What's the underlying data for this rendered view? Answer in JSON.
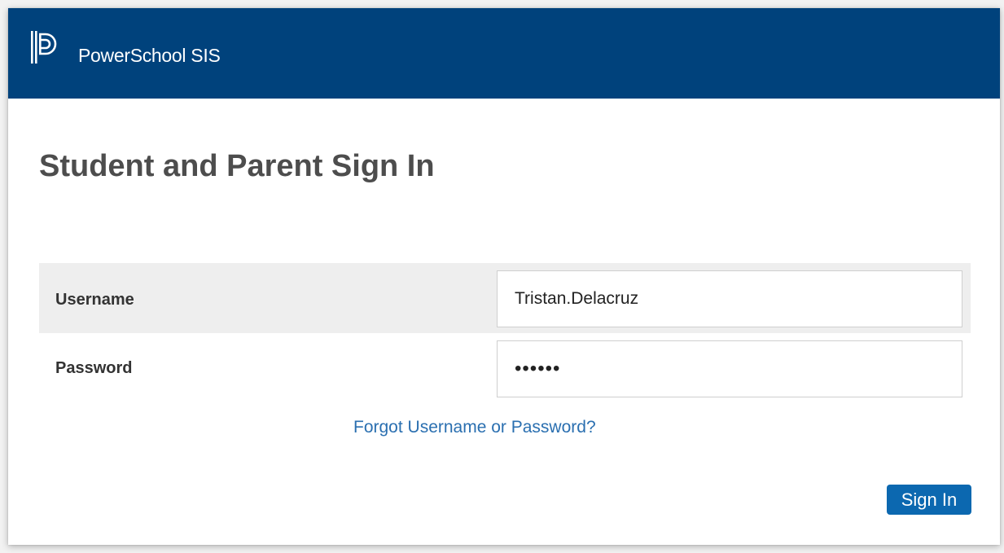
{
  "header": {
    "logo_icon": "powerschool-p-logo-icon",
    "brand_name": "PowerSchool SIS",
    "background_color": "#00427c"
  },
  "page": {
    "title": "Student and Parent Sign In"
  },
  "form": {
    "username": {
      "label": "Username",
      "value": "Tristan.Delacruz"
    },
    "password": {
      "label": "Password",
      "value": "••••••"
    },
    "forgot_link": "Forgot Username or Password?",
    "submit_label": "Sign In"
  },
  "colors": {
    "accent": "#0c68b0",
    "link": "#2a6fb0",
    "title_text": "#4d4d4d",
    "row_highlight": "#eeeeee"
  }
}
